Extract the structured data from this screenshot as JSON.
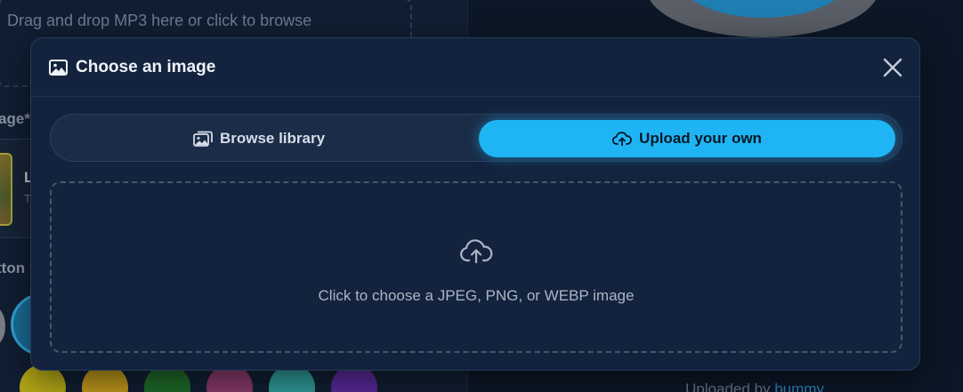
{
  "background": {
    "dropzone_text": "Drag and drop MP3 here or click to browse",
    "image_label": "age*",
    "card_letter": "L",
    "card_sub": "T",
    "button_label": "tton",
    "uploaded_prefix": "Uploaded by",
    "uploaded_user": "bummy",
    "swatch_colors": [
      "#b5a816",
      "#c19a1c",
      "#1f6b2a",
      "#8a3a6a",
      "#2f9c9a",
      "#5a2a9a"
    ]
  },
  "modal": {
    "title": "Choose an image",
    "title_icon": "image-icon",
    "close_icon": "close-icon",
    "tabs": [
      {
        "label": "Browse library",
        "icon": "images-icon",
        "active": false
      },
      {
        "label": "Upload your own",
        "icon": "cloud-upload-icon",
        "active": true
      }
    ],
    "dropzone": {
      "icon": "cloud-upload-icon",
      "text": "Click to choose a JPEG, PNG, or WEBP image"
    }
  },
  "colors": {
    "accent": "#1fb5f5",
    "modal_bg": "#13233d",
    "page_bg": "#0e1b2e"
  }
}
